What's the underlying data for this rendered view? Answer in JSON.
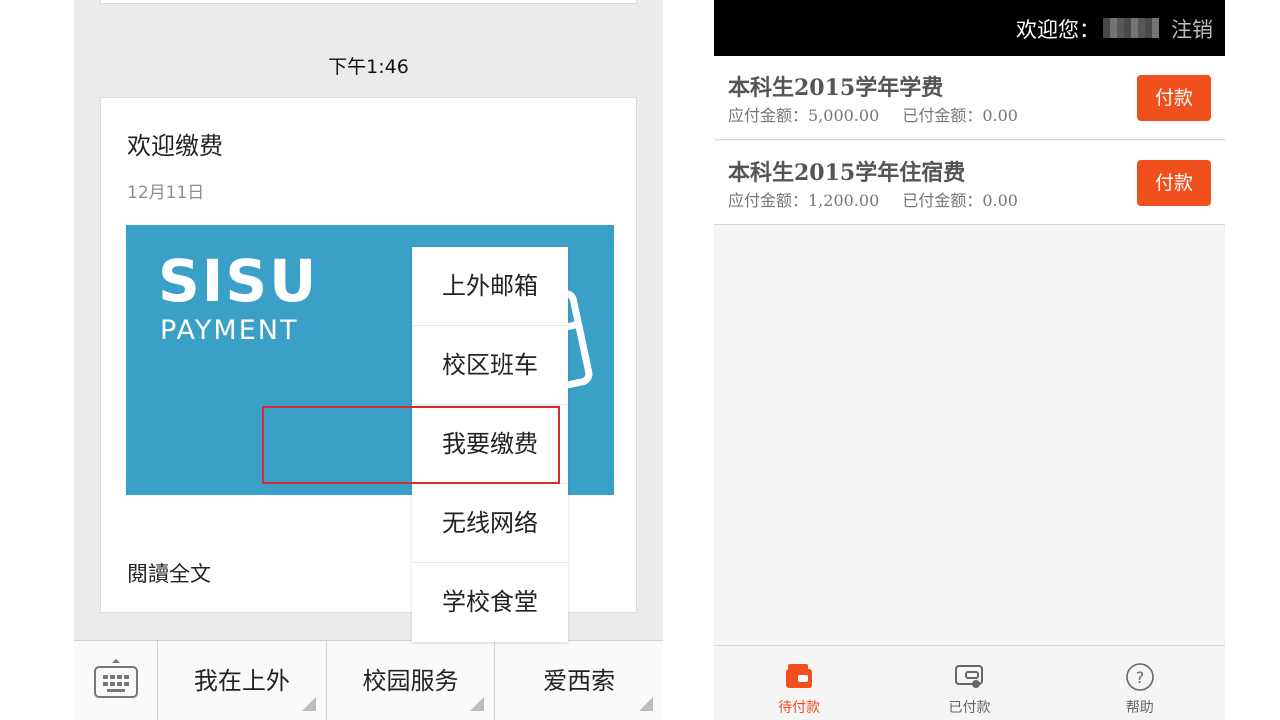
{
  "left": {
    "chat_time": "下午1:46",
    "article": {
      "title": "欢迎缴费",
      "date": "12月11日",
      "cover_brand": "SISU",
      "cover_sub": "PAYMENT",
      "read_more": "閱讀全文"
    },
    "popup_menu": {
      "items": [
        "上外邮箱",
        "校区班车",
        "我要缴费",
        "无线网络",
        "学校食堂"
      ],
      "highlighted": "我要缴费"
    },
    "bottom_menu": {
      "keyboard_icon": "keyboard-icon",
      "items": [
        "我在上外",
        "校园服务",
        "爱西索"
      ]
    }
  },
  "right": {
    "header": {
      "welcome": "欢迎您：",
      "logout": "注销"
    },
    "bills": [
      {
        "title": "本科生2015学年学费",
        "due_label": "应付金额：5,000.00",
        "paid_label": "已付金额：0.00",
        "pay_label": "付款"
      },
      {
        "title": "本科生2015学年住宿费",
        "due_label": "应付金额：1,200.00",
        "paid_label": "已付金额：0.00",
        "pay_label": "付款"
      }
    ],
    "tabs": [
      {
        "label": "待付款",
        "icon": "wallet-icon",
        "active": true
      },
      {
        "label": "已付款",
        "icon": "paid-wallet-icon",
        "active": false
      },
      {
        "label": "帮助",
        "icon": "help-icon",
        "active": false
      }
    ],
    "accent_color": "#f0501e"
  }
}
